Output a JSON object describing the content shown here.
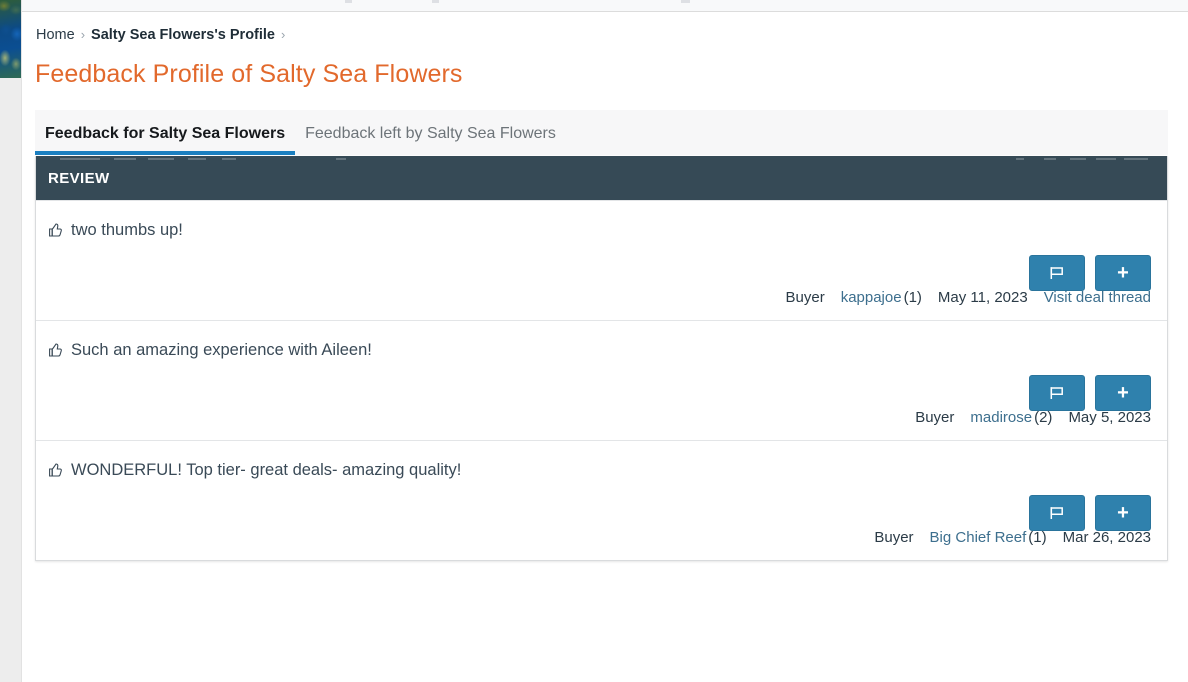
{
  "top_strip": {
    "visible": true
  },
  "left_rail": {
    "thumbnail_icon": "coral-reef-thumbnail"
  },
  "breadcrumb": {
    "home_label": "Home",
    "sep1": "›",
    "current_label": "Salty Sea Flowers's Profile",
    "sep2": "›"
  },
  "page_title": "Feedback Profile of Salty Sea Flowers",
  "tabs": [
    {
      "label": "Feedback for Salty Sea Flowers",
      "active": true
    },
    {
      "label": "Feedback left by Salty Sea Flowers",
      "active": false
    }
  ],
  "card": {
    "header_label": "REVIEW",
    "header_bg": "#364a56",
    "accent_blue": "#1b7fc0",
    "button_blue": "#2f81ad",
    "title_orange": "#e2692c"
  },
  "reviews": [
    {
      "rating_icon": "thumbs-up-icon",
      "text": "two thumbs up!",
      "flag_button_icon": "flag-icon",
      "add_button_icon": "plus-icon",
      "add_button_label": "+",
      "role": "Buyer",
      "user": "kappajoe",
      "user_count": "(1)",
      "date": "May 11, 2023",
      "deal_link": "Visit deal thread"
    },
    {
      "rating_icon": "thumbs-up-icon",
      "text": "Such an amazing experience with Aileen!",
      "flag_button_icon": "flag-icon",
      "add_button_icon": "plus-icon",
      "add_button_label": "+",
      "role": "Buyer",
      "user": "madirose",
      "user_count": "(2)",
      "date": "May 5, 2023",
      "deal_link": ""
    },
    {
      "rating_icon": "thumbs-up-icon",
      "text": "WONDERFUL! Top tier- great deals- amazing quality!",
      "flag_button_icon": "flag-icon",
      "add_button_icon": "plus-icon",
      "add_button_label": "+",
      "role": "Buyer",
      "user": "Big Chief Reef",
      "user_count": "(1)",
      "date": "Mar 26, 2023",
      "deal_link": ""
    }
  ]
}
